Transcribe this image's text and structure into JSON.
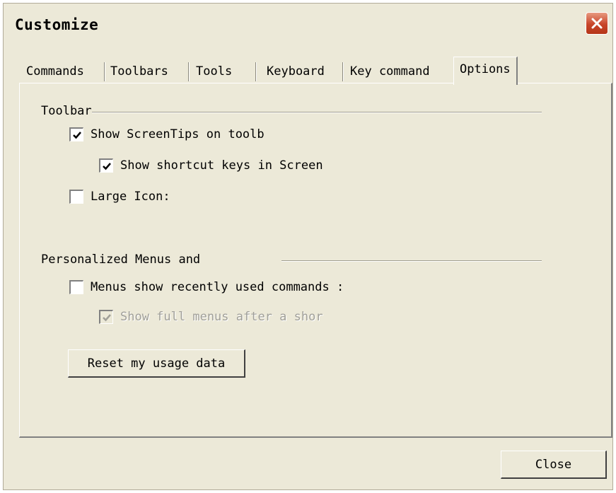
{
  "window": {
    "title": "Customize"
  },
  "tabs": [
    {
      "label": "Commands",
      "active": false
    },
    {
      "label": "Toolbars",
      "active": false
    },
    {
      "label": "Tools",
      "active": false
    },
    {
      "label": "Keyboard",
      "active": false
    },
    {
      "label": "Key command",
      "active": false
    },
    {
      "label": "Options",
      "active": true
    }
  ],
  "toolbar_group": {
    "label": "Toolbar",
    "options": [
      {
        "label": "Show ScreenTips on toolb",
        "checked": true,
        "enabled": true
      },
      {
        "label": "Show shortcut keys in Screen",
        "checked": true,
        "enabled": true
      },
      {
        "label": "Large Icon:",
        "checked": false,
        "enabled": true
      }
    ]
  },
  "menus_group": {
    "label": "Personalized Menus and",
    "options": [
      {
        "label": "Menus show recently used commands :",
        "checked": false,
        "enabled": true
      },
      {
        "label": "Show full menus after a shor",
        "checked": true,
        "enabled": false
      }
    ],
    "reset_button": "Reset my usage data"
  },
  "footer": {
    "close_button": "Close"
  },
  "colors": {
    "dialog_bg": "#ece9d8",
    "close_x": "#c8452a",
    "disabled_text": "#a09f98"
  },
  "icons": {
    "close": "close-icon",
    "check": "checkmark-icon"
  }
}
